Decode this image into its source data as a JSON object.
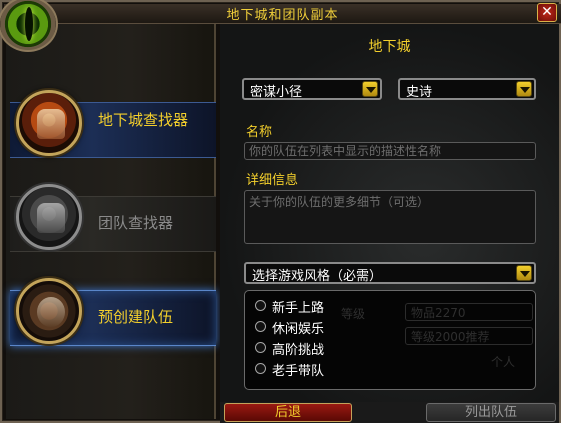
{
  "window": {
    "title": "地下城和团队副本",
    "close_label": "✕"
  },
  "sidebar": {
    "items": [
      {
        "label": "地下城查找器",
        "icon": "helmet-dungeon-icon",
        "state": "normal"
      },
      {
        "label": "团队查找器",
        "icon": "helmet-raid-icon",
        "state": "disabled"
      },
      {
        "label": "预创建队伍",
        "icon": "premade-group-icon",
        "state": "active"
      }
    ]
  },
  "main": {
    "heading": "地下城",
    "category_dropdown": "密谋小径",
    "difficulty_dropdown": "史诗",
    "name_label": "名称",
    "name_placeholder": "你的队伍在列表中显示的描述性名称",
    "details_label": "详细信息",
    "details_placeholder": "关于你的队伍的更多细节（可选）",
    "playstyle_dropdown": "选择游戏风格（必需）",
    "playstyle_options": [
      "新手上路",
      "休闲娱乐",
      "高阶挑战",
      "老手带队"
    ],
    "ghost_level_label": "等级",
    "ghost_field_1": "物品2270",
    "ghost_field_2": "等级2000推荐",
    "ghost_checkbox_label": "个人"
  },
  "footer": {
    "back_label": "后退",
    "list_label": "列出队伍"
  },
  "colors": {
    "gold": "#f3cf2c",
    "active_glow": "#3e74c9",
    "back_button": "#9a1a12"
  }
}
